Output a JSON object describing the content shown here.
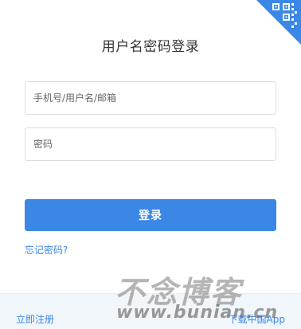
{
  "qr_login": {
    "icon": "qr-code-icon",
    "accent_color": "#3b87e6"
  },
  "title": "用户名密码登录",
  "form": {
    "username_placeholder": "手机号/用户名/邮箱",
    "password_placeholder": "密码",
    "login_label": "登录",
    "forgot_label": "忘记密码?"
  },
  "footer": {
    "register_label": "立即注册",
    "download_label": "下载中国App"
  },
  "watermark": {
    "title": "不念博客",
    "url": "www.bunian.cn"
  }
}
